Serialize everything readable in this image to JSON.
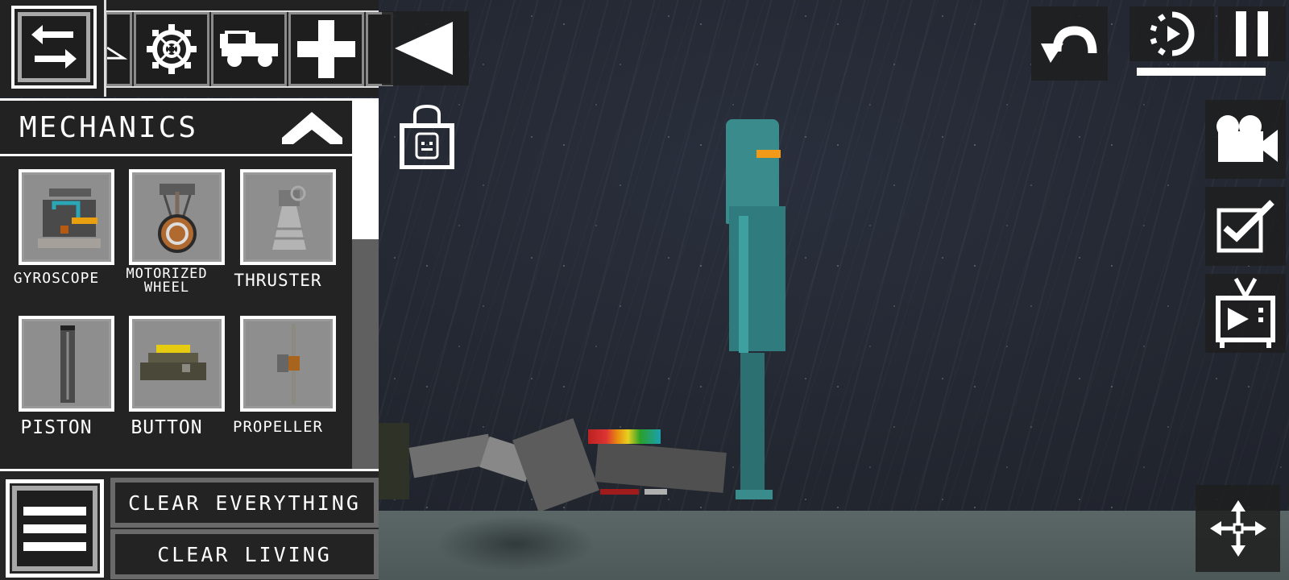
{
  "top_bar": {
    "tabs": [
      {
        "id": "swap",
        "icon": "swap-arrows-icon"
      },
      {
        "id": "partial-previous",
        "icon": "partial-tab-icon"
      },
      {
        "id": "mechanics",
        "icon": "gear-wheel-icon"
      },
      {
        "id": "vehicles",
        "icon": "jeep-icon"
      },
      {
        "id": "medical",
        "icon": "plus-icon"
      },
      {
        "id": "next-partial",
        "icon": "partial-tab-icon"
      }
    ]
  },
  "category": {
    "title": "MECHANICS",
    "toggle_icon": "chevron-up-icon"
  },
  "items": [
    {
      "label": "GYROSCOPE"
    },
    {
      "label": "MOTORIZED",
      "label2": "WHEEL"
    },
    {
      "label": "THRUSTER"
    },
    {
      "label": "PISTON"
    },
    {
      "label": "BUTTON"
    },
    {
      "label": "PROPELLER"
    }
  ],
  "scrollbar": {
    "thumb_fraction": 0.38
  },
  "bottom": {
    "clear_everything": "CLEAR EVERYTHING",
    "clear_living": "CLEAR LIVING"
  },
  "controls": {
    "slow_motion_level": 1.0,
    "accent": "#ffffff",
    "panel_bg": "#232323"
  },
  "scene": {
    "character": "android",
    "visor_color": "#f29a18",
    "body_color": "#2f7b7d"
  }
}
